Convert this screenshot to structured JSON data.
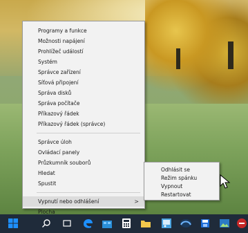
{
  "context_menu": {
    "groups": [
      [
        "Programy a funkce",
        "Možnosti napájení",
        "Prohlížeč událostí",
        "Systém",
        "Správce zařízení",
        "Síťová připojení",
        "Správa disků",
        "Správa počítače",
        "Příkazový řádek",
        "Příkazový řádek (správce)"
      ],
      [
        "Správce úloh",
        "Ovládací panely",
        "Průzkumník souborů",
        "Hledat",
        "Spustit"
      ],
      [
        "Vypnutí nebo odhlášení",
        "Plocha"
      ]
    ],
    "submenu_indicator": ">"
  },
  "submenu": {
    "items": [
      "Odhlásit se",
      "Režim spánku",
      "Vypnout",
      "Restartovat"
    ]
  },
  "taskbar": {
    "icons": [
      "windows-start-icon",
      "search-icon",
      "task-view-icon",
      "edge-browser-icon",
      "store-icon",
      "calculator-icon",
      "file-explorer-icon",
      "paint-icon",
      "steam-icon",
      "save-disk-icon",
      "photos-icon",
      "red-app-icon"
    ]
  },
  "colors": {
    "menu_bg": "#f2f2f2",
    "menu_highlight": "#dcdcdc",
    "taskbar_bg": "#1f2b3a",
    "windows_blue": "#1e90ff"
  }
}
